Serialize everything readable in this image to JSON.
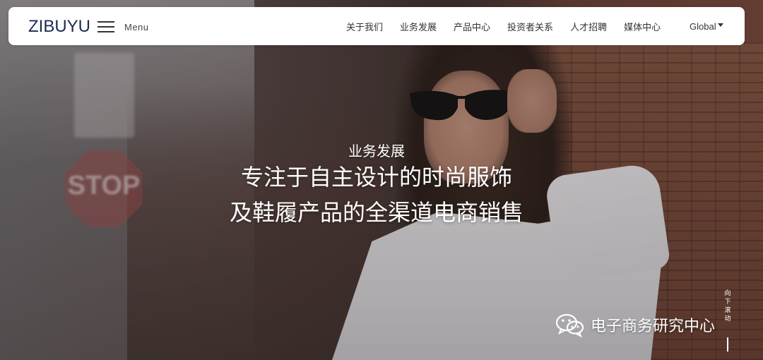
{
  "header": {
    "logo_text": "ZIBUYU",
    "menu_label": "Menu",
    "nav_items": [
      {
        "label": "关于我们"
      },
      {
        "label": "业务发展"
      },
      {
        "label": "产品中心"
      },
      {
        "label": "投资者关系"
      },
      {
        "label": "人才招聘"
      },
      {
        "label": "媒体中心"
      }
    ],
    "global_label": "Global"
  },
  "hero": {
    "subtitle": "业务发展",
    "title_line1": "专注于自主设计的时尚服饰",
    "title_line2": "及鞋履产品的全渠道电商销售",
    "background_sign_text": "STOP"
  },
  "scroll_hint": {
    "chars": [
      "向",
      "下",
      "滚",
      "动"
    ]
  },
  "watermark": {
    "text": "电子商务研究中心",
    "icon": "wechat-icon"
  },
  "colors": {
    "logo": "#1d2a52",
    "nav_text": "#333333",
    "hero_text": "#ffffff"
  }
}
